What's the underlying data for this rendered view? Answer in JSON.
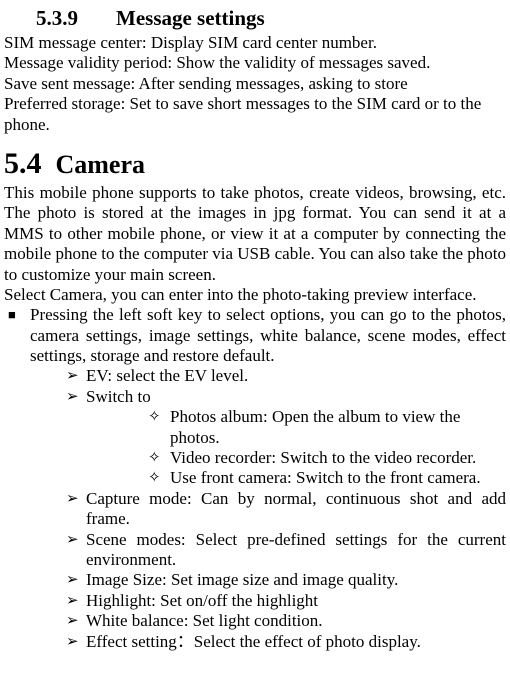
{
  "section539": {
    "number": "5.3.9",
    "title": "Message settings",
    "lines": [
      "SIM message center: Display SIM card center number.",
      "Message validity period: Show the validity of messages saved.",
      "Save sent message: After sending messages, asking to store",
      "Preferred storage: Set to save short messages to the SIM card or to the phone."
    ]
  },
  "chapter54": {
    "number": "5.4",
    "title": "Camera",
    "paragraph1": "This mobile phone supports to take photos, create videos, browsing, etc. The photo is stored at the images in jpg format. You can send it at a MMS to other mobile phone, or view it at a computer by connecting the mobile phone to the computer via USB cable. You can also take the photo to customize your main screen.",
    "paragraph2": "Select Camera, you can enter into the photo-taking preview interface.",
    "bullet_main": "Pressing the left soft key to select options, you can go to the photos, camera settings, image settings, white balance, scene modes, effect settings, storage and restore default.",
    "arrows": {
      "ev": "EV: select the EV level.",
      "switchto": "Switch to",
      "capture": "Capture mode: Can by normal, continuous shot and add frame.",
      "scene": "Scene modes: Select pre-defined settings for the current environment.",
      "imagesize": "Image Size: Set image size and image quality.",
      "highlight": "Highlight: Set on/off the highlight",
      "whitebalance": "White balance: Set light condition.",
      "effect": "Effect setting：Select the effect of photo display."
    },
    "diamonds": {
      "photos": "Photos album: Open the album to view the photos.",
      "video": "Video recorder: Switch to the video recorder.",
      "front": "Use front camera: Switch to the front camera."
    }
  }
}
